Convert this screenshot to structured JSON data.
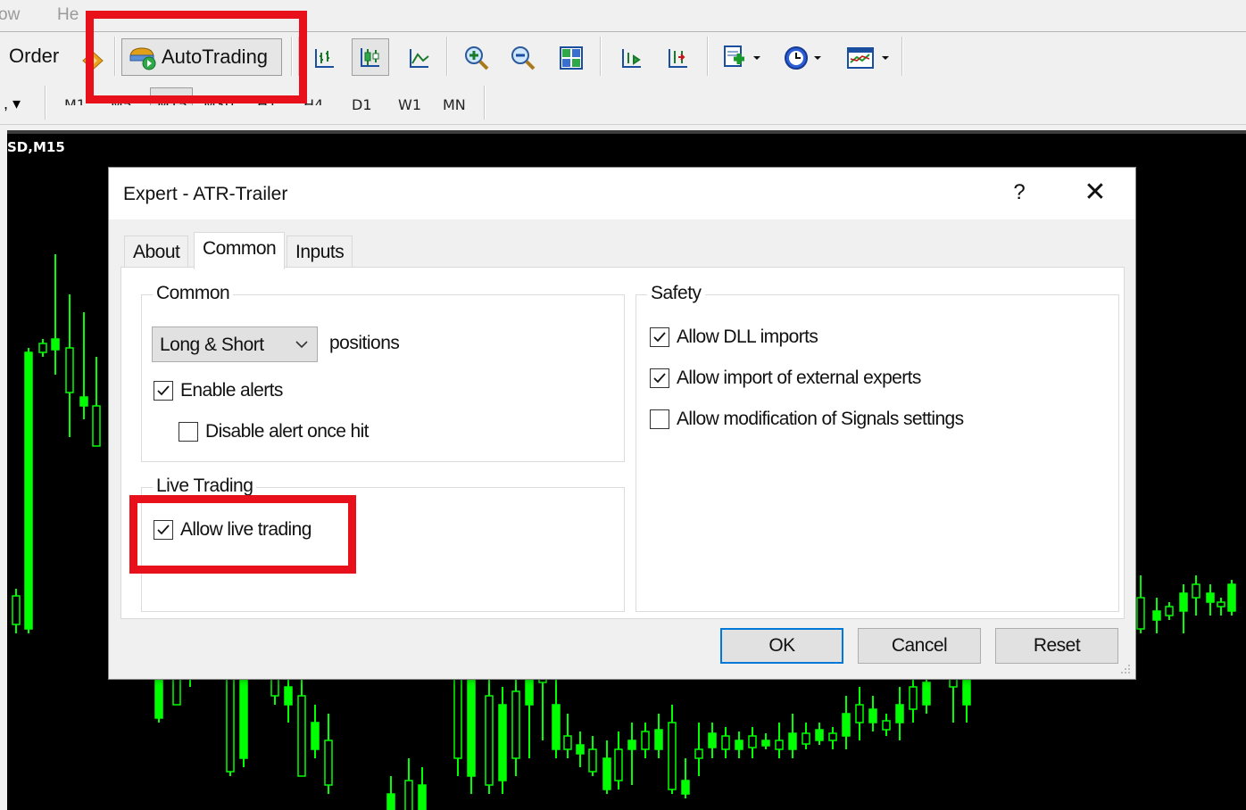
{
  "menu": {
    "items": [
      "ow",
      "He"
    ]
  },
  "toolbar": {
    "order_label": "Order",
    "autotrading_label": "AutoTrading"
  },
  "timeframes": [
    "M1",
    "M5",
    "M15",
    "M30",
    "H1",
    "H4",
    "D1",
    "W1",
    "MN"
  ],
  "chart": {
    "symbol_label": "SD,M15"
  },
  "dialog": {
    "title": "Expert - ATR-Trailer",
    "help_glyph": "?",
    "close_glyph": "✕",
    "tabs": [
      {
        "label": "About",
        "active": false
      },
      {
        "label": "Common",
        "active": true
      },
      {
        "label": "Inputs",
        "active": false
      }
    ],
    "common_group": {
      "title": "Common",
      "positions_select": {
        "value": "Long & Short",
        "suffix": "positions"
      },
      "enable_alerts": {
        "label": "Enable alerts",
        "checked": true
      },
      "disable_alert_once_hit": {
        "label": "Disable alert once hit",
        "checked": false
      }
    },
    "live_group": {
      "title": "Live Trading",
      "allow_live_trading": {
        "label": "Allow live trading",
        "checked": true
      }
    },
    "safety_group": {
      "title": "Safety",
      "allow_dll_imports": {
        "label": "Allow DLL imports",
        "checked": true
      },
      "allow_import_external": {
        "label": "Allow import of external experts",
        "checked": true
      },
      "allow_modification_signals": {
        "label": "Allow modification of Signals settings",
        "checked": false
      }
    },
    "buttons": {
      "ok": "OK",
      "cancel": "Cancel",
      "reset": "Reset"
    }
  },
  "colors": {
    "highlight": "#e8101a",
    "candle": "#00ff00",
    "chart_bg": "#000000",
    "default_button_border": "#0078d7"
  }
}
